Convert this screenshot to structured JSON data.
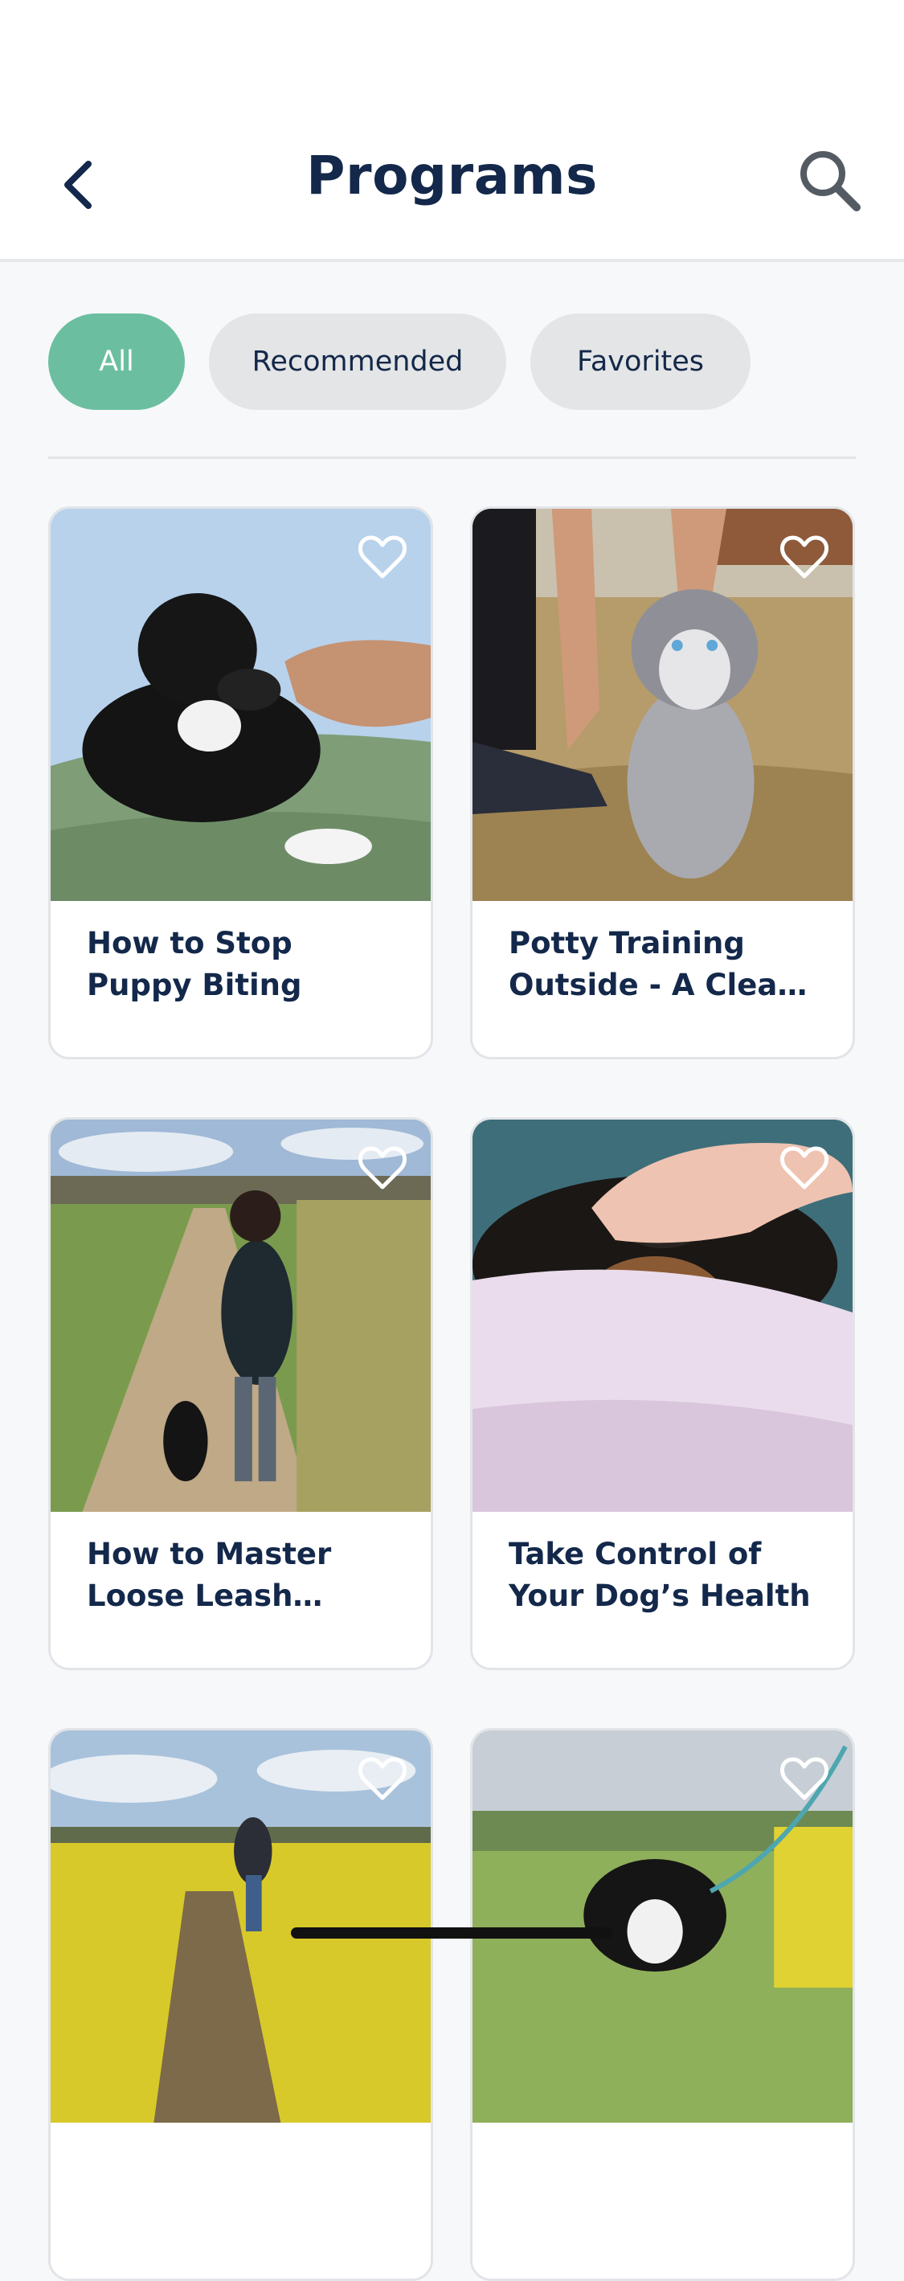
{
  "header": {
    "title": "Programs",
    "back_icon": "chevron-left-icon",
    "search_icon": "search-icon"
  },
  "filters": [
    {
      "label": "All",
      "active": true
    },
    {
      "label": "Recommended",
      "active": false
    },
    {
      "label": "Favorites",
      "active": false
    }
  ],
  "programs": [
    {
      "title": "How to Stop Puppy Biting",
      "favorite": false
    },
    {
      "title": "Potty Training Outside - A Clean Home for Good",
      "favorite": false
    },
    {
      "title": "How to Master Loose Leash Walking",
      "favorite": false
    },
    {
      "title": "Take Control of Your Dog’s Health",
      "favorite": false
    },
    {
      "title": "",
      "favorite": false
    },
    {
      "title": "",
      "favorite": false
    }
  ],
  "colors": {
    "accent": "#6bbfa0",
    "title_text": "#13284a",
    "chip_bg": "#e4e5e6"
  }
}
